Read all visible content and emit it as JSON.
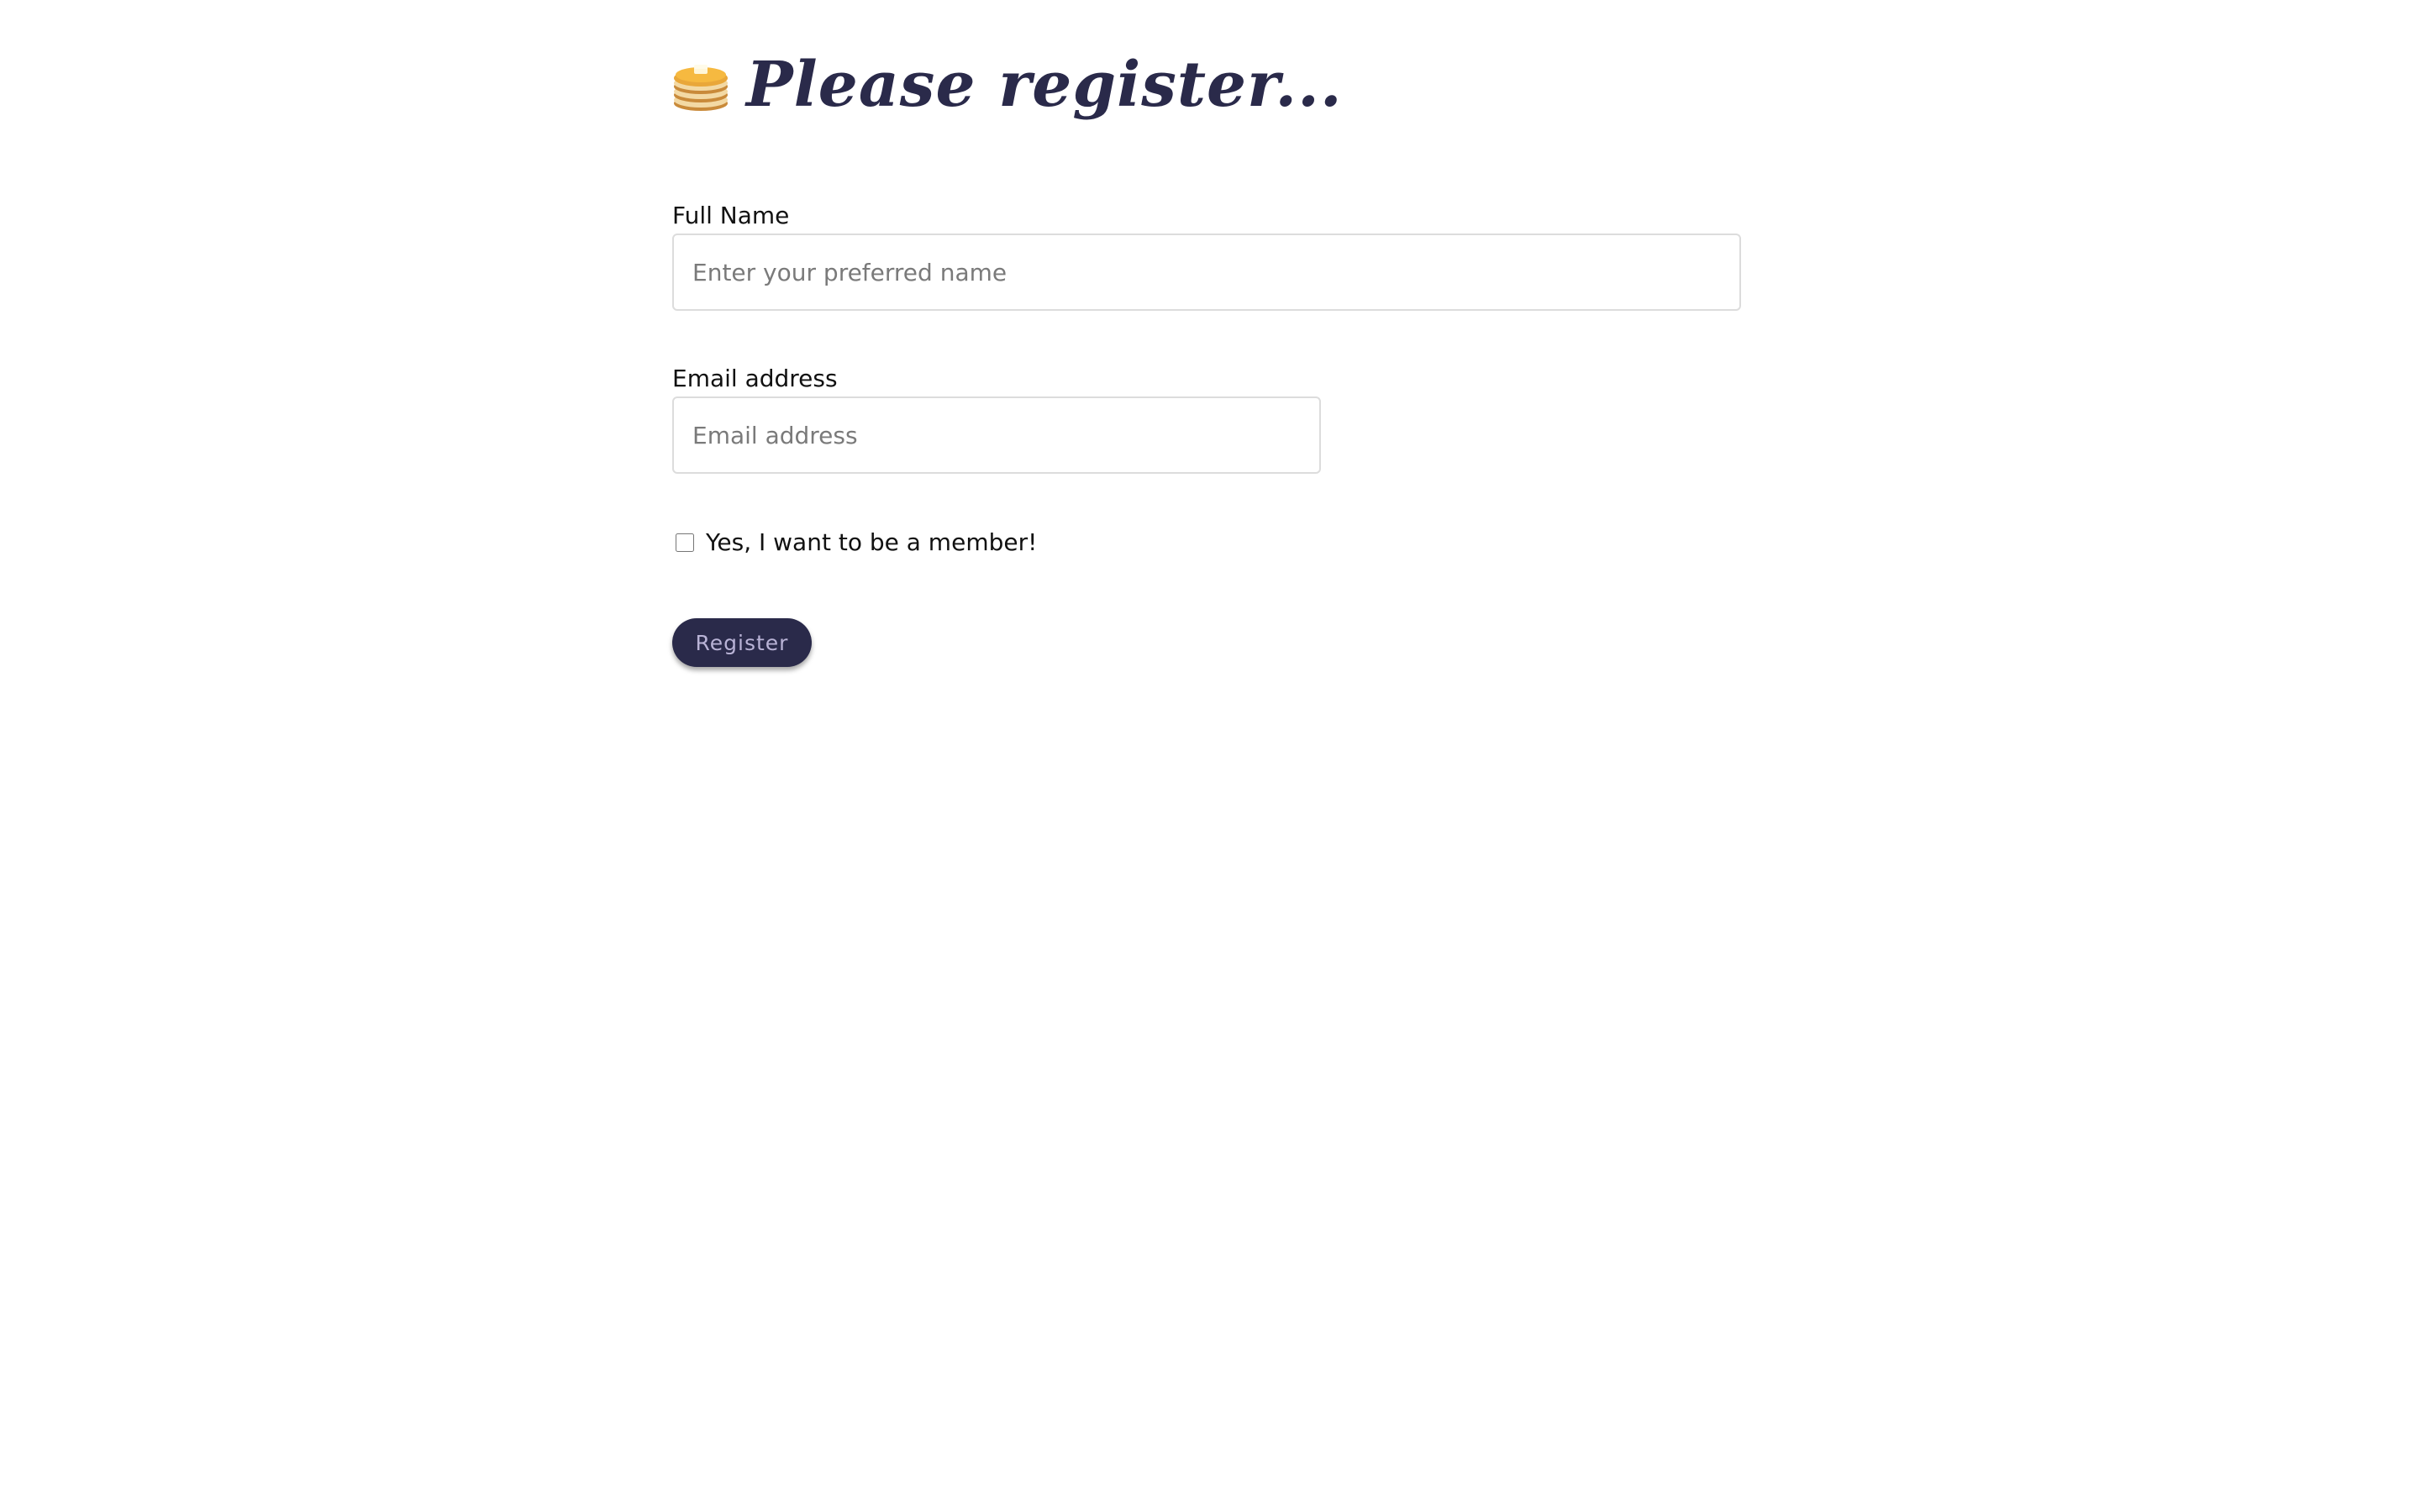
{
  "header": {
    "icon": "pancakes-icon",
    "title": "Please register..."
  },
  "form": {
    "full_name": {
      "label": "Full Name",
      "value": "",
      "placeholder": "Enter your preferred name"
    },
    "email": {
      "label": "Email address",
      "value": "",
      "placeholder": "Email address"
    },
    "member_checkbox": {
      "label": "Yes, I want to be a member!",
      "checked": false
    },
    "submit_label": "Register"
  },
  "colors": {
    "title": "#2a2a4a",
    "button_bg": "#2a2a4a",
    "button_text": "#b9b3d6",
    "input_border": "#dcdcdc",
    "placeholder": "#7a7a7a"
  }
}
